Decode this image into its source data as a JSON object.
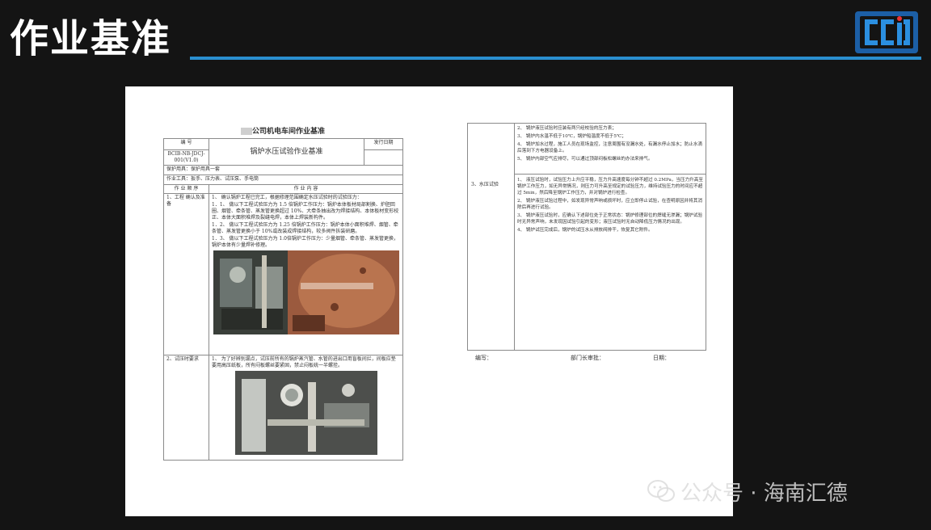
{
  "slide": {
    "title": "作业基准",
    "accent": "#2a8fd0"
  },
  "logo": {
    "icon": "cci-logo-icon",
    "color": "#1c5fa6"
  },
  "document": {
    "company": "公司机电车间作业基准",
    "header": {
      "number_label": "编 号",
      "number_value": "BCIB-NB-JDCJ-001(V1.0)",
      "title": "锅炉水压试验作业基准",
      "issue_date_label": "发行日期"
    },
    "protection": "保护用具：保护用具一套",
    "tools": "作业工具：扳手、压力表、试压泵、手电筒",
    "col_sequence": "作 业 顺 序",
    "col_content": "作 业 内 容",
    "step1": {
      "label": "1、工程 确认及准备",
      "lines": [
        "1、 确认锅炉工程已完工，根据修理范围确定水压试验时的试验压力：",
        "1．1、 做以下工程试验压力为 1.5 倍锅炉工作压力：锅炉本体板材局部割换、炉胆回圈、烟管、牵条管、蒸发管更换超过 10%、大牵条抽出改为焊接结构、本体板材变形校正、本体大面积堆焊及裂缝电焊，本体上焊装新构件。",
        "1．2、 做以下工程试验压力为 1.25 倍锅炉工作压力：锅炉本体小面积堆焊、烟管、牵条管、蒸发管更换小于 10%或改装成焊接结构，较多阀件拆装研磨。",
        "1．3、 做以下工程试验压力为 1.0倍锅炉工作压力：少量烟管、牵条管、蒸发管更换，锅炉本体有少量焊补修理。"
      ]
    },
    "step2": {
      "label": "2、试压时要求",
      "lines": [
        "1、 为了好辨别漏点，试压前所有的锅炉蒸汽管、水管的进出口用盲板间拦，间板应垫要用高压纸板，所有闷板螺丝要紧固，禁止闷板统一半螺拴。"
      ]
    },
    "step3": {
      "label": "3、水压试验",
      "block_a": [
        "2、 锅炉液压试验时应装有两只经校验的压力表；",
        "3、 锅炉内水温不低于10℃，锅炉船温度不低于5℃；",
        "4、 锅炉加水过程，施工人员在现场监控，注意周围有没漏水处，有漏水停止加水；防止水滴后落到下方电器设备上。",
        "5、 锅炉内部空气应排尽，可以通过顶部闷板松螺丝的办法来排气。"
      ],
      "block_b": [
        "1、 液压试验时，试验压力上升应平稳，压力升高速度每分钟不超过 0.2MPa，当压力升高至锅炉工作压力，如无异常情况，则压力可升高至规定的试验压力，维持试验压力的时间应不超过 5min，然后降至锅炉工作压力，并对锅炉进行检查。",
        "2、 锅炉液压试验过程中，如发现异常声响或损坏时，应立即停止试验，在查明原因并将其消除后再进行试验。",
        "3、 锅炉液压试验时，应确认下述部位处于正常状态：锅炉修理部位的焊缝无渗漏；锅炉试验时无异常声响，未发现因试验引起的变形；液压试验时无自动降低压力情况的出现。",
        "4、 锅炉试压完成后，锅炉的试压水从排放阀排干，恢复其它附件。"
      ]
    },
    "footer": {
      "writer": "编写：",
      "approver": "部门长审批：",
      "date": "日期："
    }
  },
  "watermark": {
    "icon": "wechat-icon",
    "text": "公众号 · 海南汇德"
  }
}
